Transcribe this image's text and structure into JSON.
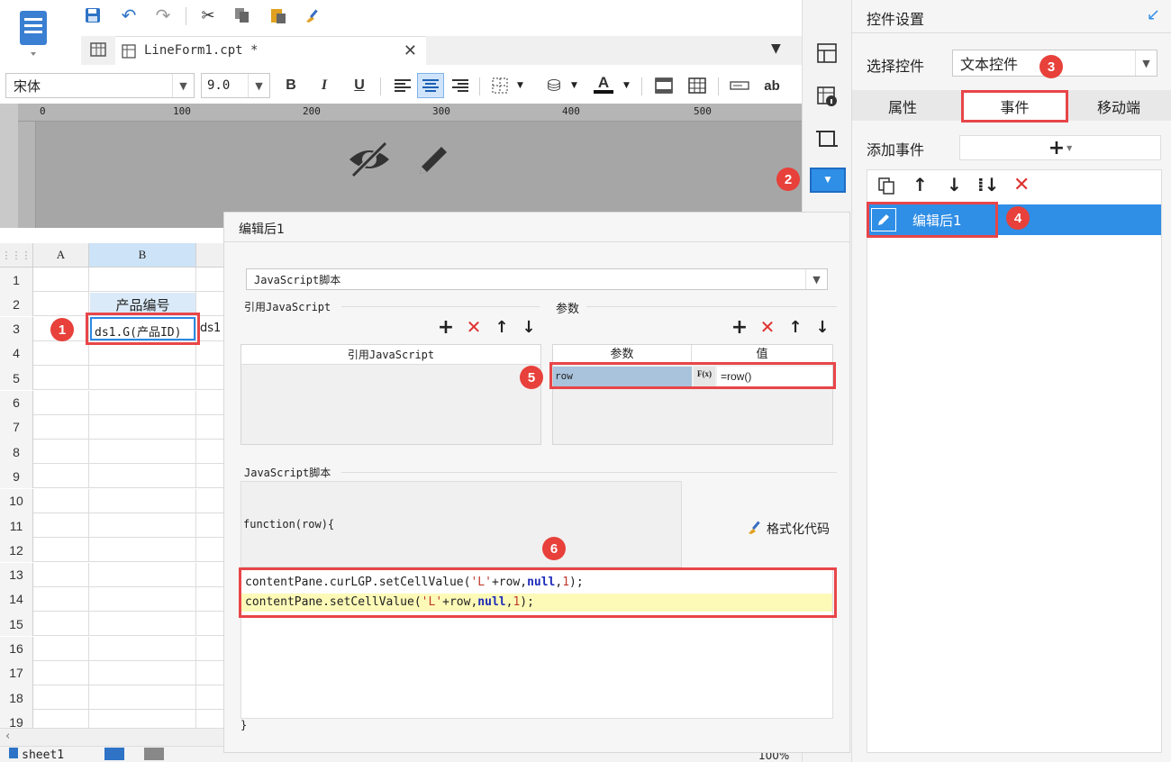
{
  "toolbar": {
    "tab_label": "LineForm1.cpt *",
    "font_name": "宋体",
    "font_size": "9.0",
    "bold": "B",
    "italic": "I",
    "underline": "U",
    "text_color": "A",
    "ab": "ab"
  },
  "ruler": {
    "ticks": [
      "0",
      "100",
      "200",
      "300",
      "400",
      "500"
    ]
  },
  "sheet": {
    "col_headers": [
      "A",
      "B"
    ],
    "row_numbers": [
      "1",
      "2",
      "3",
      "4",
      "5",
      "6",
      "7",
      "8",
      "9",
      "10",
      "11",
      "12",
      "13",
      "14",
      "15",
      "16",
      "17",
      "18",
      "19"
    ],
    "b2": "产品编号",
    "b3": "ds1.G(产品ID)",
    "c3": "ds1",
    "sheet_tab": "sheet1",
    "zoom": "100%"
  },
  "dialog": {
    "title": "编辑后1",
    "type_select": "JavaScript脚本",
    "ref_js_label": "引用JavaScript",
    "params_label": "参数",
    "ref_js_col": "引用JavaScript",
    "param_col": "参数",
    "value_col": "值",
    "param_name": "row",
    "param_value": "=row()",
    "fx": "F(x)",
    "script_label": "JavaScript脚本",
    "function_sig": "function(row){",
    "format_code": "格式化代码",
    "code_line1": {
      "a": "contentPane.curLGP.setCellValue(",
      "s": "'L'",
      "b": "+row,",
      "k": "null",
      "c": ",",
      "n": "1",
      "d": ");"
    },
    "code_line2": {
      "a": "contentPane.setCellValue(",
      "s": "'L'",
      "b": "+row,",
      "k": "null",
      "c": ",",
      "n": "1",
      "d": ");"
    },
    "closing": "}"
  },
  "panel": {
    "title": "控件设置",
    "select_label": "选择控件",
    "select_value": "文本控件",
    "tabs": [
      "属性",
      "事件",
      "移动端"
    ],
    "add_event_label": "添加事件",
    "add_symbol": "+",
    "event_item": "编辑后1"
  },
  "badges": [
    "1",
    "2",
    "3",
    "4",
    "5",
    "6"
  ],
  "colors": {
    "accent_blue": "#2f8ee6",
    "badge_red": "#e8403a",
    "highlight_yellow": "#fdfab8",
    "selection_blue": "#2b89e4"
  }
}
